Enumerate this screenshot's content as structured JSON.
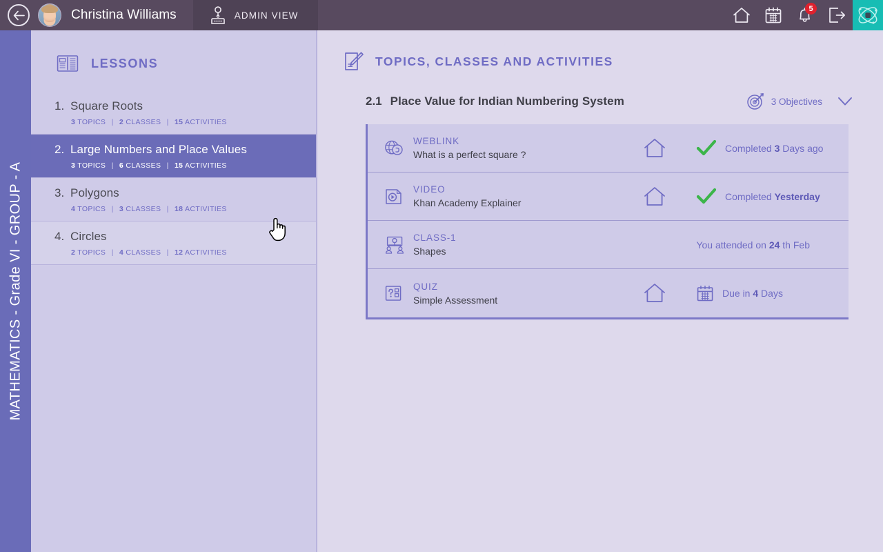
{
  "topbar": {
    "back_icon": "back-arrow-icon",
    "avatar_icon": "user-avatar",
    "user_name": "Christina Williams",
    "admin_tab": {
      "icon": "admin-user-icon",
      "label": "ADMIN VIEW"
    },
    "icons": [
      {
        "name": "home-icon",
        "label": "Home"
      },
      {
        "name": "calendar-icon",
        "label": "Calendar"
      },
      {
        "name": "notification-bell-icon",
        "label": "Notifications",
        "badge": "5"
      },
      {
        "name": "logout-icon",
        "label": "Logout"
      }
    ],
    "logo": {
      "name": "atom-logo-icon",
      "color": "#17bdb4"
    }
  },
  "left_rail": {
    "label": "MATHEMATICS - Grade VI - GROUP - A",
    "color": "#6a6cb8"
  },
  "lessons": {
    "header_icon": "open-book-icon",
    "header_title": "LESSONS",
    "items": [
      {
        "num": "1.",
        "title": "Square Roots",
        "topics": "3",
        "topics_label": "TOPICS",
        "classes": "2",
        "classes_label": "CLASSES",
        "activities": "15",
        "activities_label": "ACTIVITIES",
        "state": "normal"
      },
      {
        "num": "2.",
        "title": "Large Numbers and Place Values",
        "topics": "3",
        "topics_label": "TOPICS",
        "classes": "6",
        "classes_label": "CLASSES",
        "activities": "15",
        "activities_label": "ACTIVITIES",
        "state": "active"
      },
      {
        "num": "3.",
        "title": "Polygons",
        "topics": "4",
        "topics_label": "TOPICS",
        "classes": "3",
        "classes_label": "CLASSES",
        "activities": "18",
        "activities_label": "ACTIVITIES",
        "state": "normal"
      },
      {
        "num": "4.",
        "title": "Circles",
        "topics": "2",
        "topics_label": "TOPICS",
        "classes": "4",
        "classes_label": "CLASSES",
        "activities": "12",
        "activities_label": "ACTIVITIES",
        "state": "hover"
      }
    ]
  },
  "content": {
    "header_icon": "notepad-pencil-icon",
    "header_title": "TOPICS, CLASSES AND ACTIVITIES",
    "topic": {
      "number": "2.1",
      "name": "Place Value for Indian Numbering System",
      "objectives_icon": "target-dart-icon",
      "objectives_text": "3 Objectives",
      "chevron_icon": "chevron-down-icon"
    },
    "activities": [
      {
        "icon": "weblink-globe-icon",
        "type": "WEBLINK",
        "desc": "What is a perfect square ?",
        "has_home": true,
        "status_icon": "green-check-icon",
        "status_prefix": "Completed ",
        "status_strong": "3",
        "status_suffix": " Days ago",
        "status_align": "left"
      },
      {
        "icon": "video-icon",
        "type": "VIDEO",
        "desc": "Khan Academy Explainer",
        "has_home": true,
        "status_icon": "green-check-icon",
        "status_prefix": "Completed ",
        "status_strong": "Yesterday",
        "status_suffix": "",
        "status_align": "left"
      },
      {
        "icon": "class-group-icon",
        "type": "CLASS-1",
        "desc": "Shapes",
        "has_home": false,
        "status_icon": "",
        "status_prefix": "You attended on ",
        "status_strong": "24",
        "status_suffix": " th Feb",
        "status_align": "right"
      },
      {
        "icon": "quiz-icon",
        "type": "QUIZ",
        "desc": "Simple Assessment",
        "has_home": true,
        "status_icon": "calendar-icon",
        "status_prefix": "Due in ",
        "status_strong": "4",
        "status_suffix": " Days",
        "status_align": "left"
      }
    ]
  },
  "cursor": {
    "name": "pointing-hand-cursor"
  },
  "colors": {
    "topbar": "#584a5f",
    "rail": "#6a6cb8",
    "accent_purple": "#6f6cc4",
    "panel_light": "#ded9ec",
    "card": "#cfcbe8",
    "check_green": "#3cb54a",
    "badge_red": "#e0212e",
    "teal": "#17bdb4"
  }
}
